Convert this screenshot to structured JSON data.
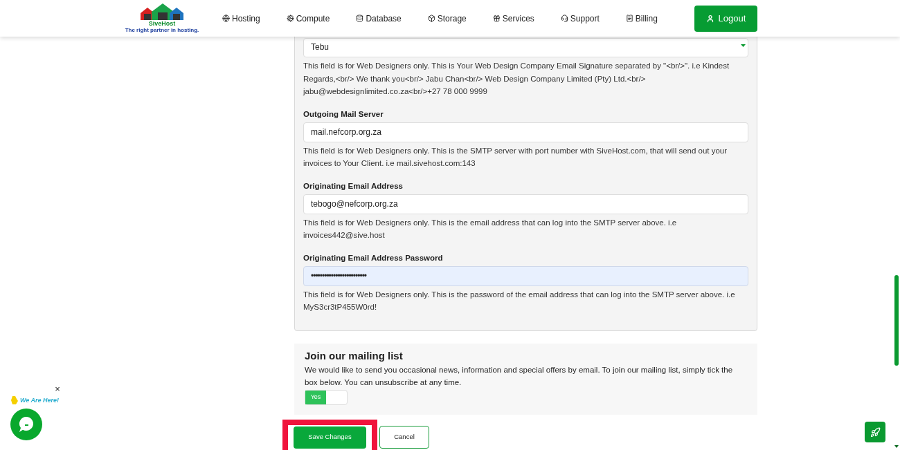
{
  "logo": {
    "name": "SiveHost",
    "tagline": "The right partner in hosting."
  },
  "nav": [
    {
      "label": "Hosting"
    },
    {
      "label": "Compute"
    },
    {
      "label": "Database"
    },
    {
      "label": "Storage"
    },
    {
      "label": "Services"
    },
    {
      "label": "Support"
    },
    {
      "label": "Billing"
    }
  ],
  "logout": "Logout",
  "signature": {
    "value": "Tebu",
    "help": "This field is for Web Designers only. This is Your Web Design Company Email Signature separated by \"<br/>\". i.e Kindest Regards,<br/> We thank you<br/> Jabu Chan<br/> Web Design Company Limited (Pty) Ltd.<br/> jabu@webdesignlimited.co.za<br/>+27 78 000 9999"
  },
  "fields": [
    {
      "label": "Outgoing Mail Server",
      "value": "mail.nefcorp.org.za",
      "kind": "text",
      "help": "This field is for Web Designers only. This is the SMTP server with port number with SiveHost.com, that will send out your invoices to Your Client. i.e mail.sivehost.com:143"
    },
    {
      "label": "Originating Email Address",
      "value": "tebogo@nefcorp.org.za",
      "kind": "text",
      "help": "This field is for Web Designers only. This is the email address that can log into the SMTP server above. i.e invoices442@sive.host"
    },
    {
      "label": "Originating Email Address Password",
      "value": "•••••••••••••••••••••••••",
      "kind": "password",
      "help": "This field is for Web Designers only. This is the password of the email address that can log into the SMTP server above. i.e MyS3cr3tP455W0rd!"
    }
  ],
  "mailing": {
    "title": "Join our mailing list",
    "text": "We would like to send you occasional news, information and special offers by email. To join our mailing list, simply tick the box below. You can unsubscribe at any time.",
    "toggle_label": "Yes",
    "checked": true
  },
  "buttons": {
    "save": "Save Changes",
    "cancel": "Cancel"
  },
  "chat": {
    "greeting": "We Are Here!",
    "close": "×"
  }
}
